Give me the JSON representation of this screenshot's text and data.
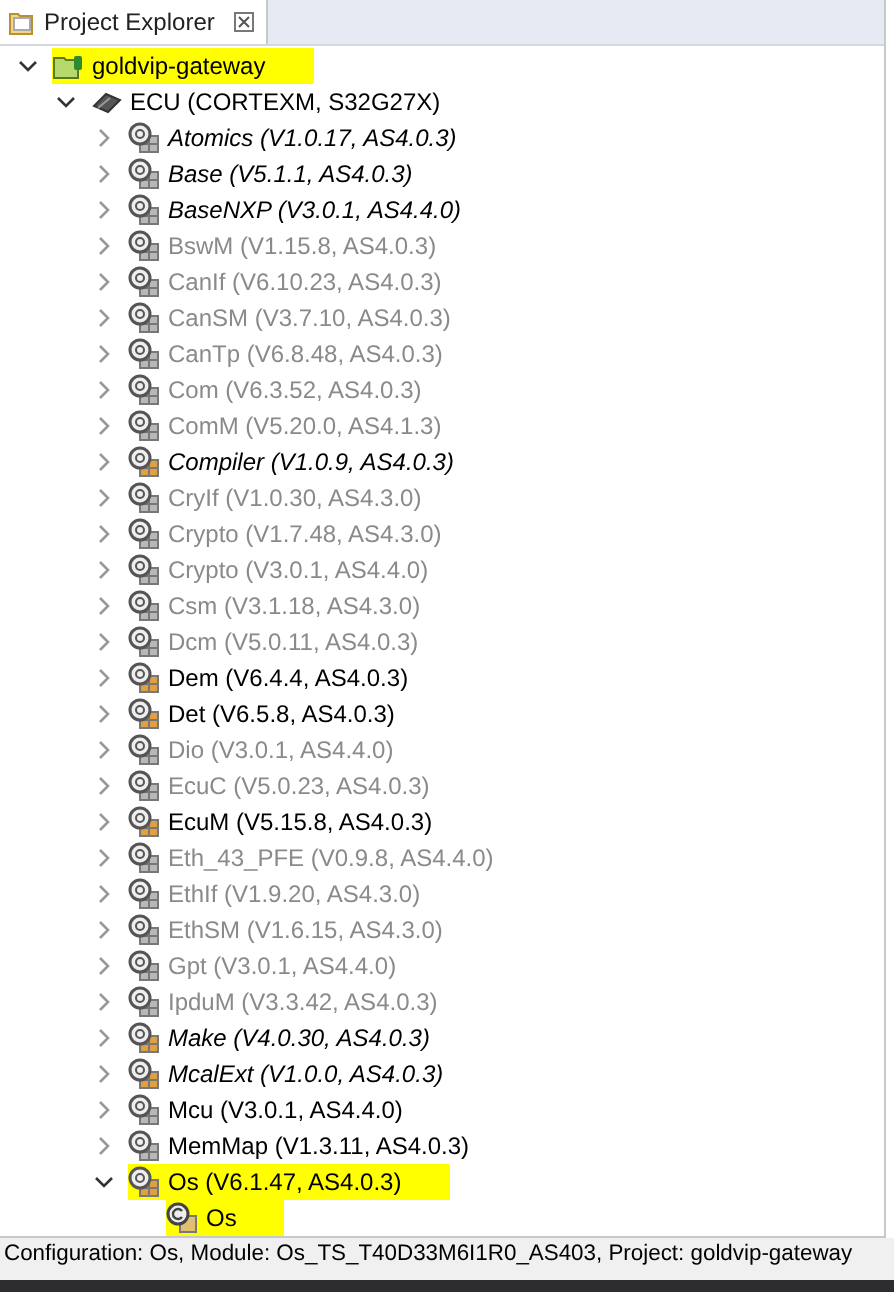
{
  "tab": {
    "title": "Project Explorer",
    "selected": true
  },
  "tree": [
    {
      "kind": "project",
      "label": "goldvip-gateway",
      "expanded": true,
      "highlighted": true,
      "children": [
        {
          "kind": "ecu",
          "label": "ECU (CORTEXM, S32G27X)",
          "expanded": true,
          "highlighted": false,
          "children": [
            {
              "kind": "module",
              "label": "Atomics (V1.0.17, AS4.0.3)",
              "read_only": true,
              "disabled": false,
              "enabled": false,
              "expanded": false,
              "highlighted": false
            },
            {
              "kind": "module",
              "label": "Base (V5.1.1, AS4.0.3)",
              "read_only": true,
              "disabled": false,
              "enabled": false,
              "expanded": false,
              "highlighted": false
            },
            {
              "kind": "module",
              "label": "BaseNXP (V3.0.1, AS4.4.0)",
              "read_only": true,
              "disabled": false,
              "enabled": false,
              "expanded": false,
              "highlighted": false
            },
            {
              "kind": "module",
              "label": "BswM (V1.15.8, AS4.0.3)",
              "read_only": false,
              "disabled": true,
              "enabled": false,
              "expanded": false,
              "highlighted": false
            },
            {
              "kind": "module",
              "label": "CanIf (V6.10.23, AS4.0.3)",
              "read_only": false,
              "disabled": true,
              "enabled": false,
              "expanded": false,
              "highlighted": false
            },
            {
              "kind": "module",
              "label": "CanSM (V3.7.10, AS4.0.3)",
              "read_only": false,
              "disabled": true,
              "enabled": false,
              "expanded": false,
              "highlighted": false
            },
            {
              "kind": "module",
              "label": "CanTp (V6.8.48, AS4.0.3)",
              "read_only": false,
              "disabled": true,
              "enabled": false,
              "expanded": false,
              "highlighted": false
            },
            {
              "kind": "module",
              "label": "Com (V6.3.52, AS4.0.3)",
              "read_only": false,
              "disabled": true,
              "enabled": false,
              "expanded": false,
              "highlighted": false
            },
            {
              "kind": "module",
              "label": "ComM (V5.20.0, AS4.1.3)",
              "read_only": false,
              "disabled": true,
              "enabled": false,
              "expanded": false,
              "highlighted": false
            },
            {
              "kind": "module",
              "label": "Compiler (V1.0.9, AS4.0.3)",
              "read_only": true,
              "disabled": false,
              "enabled": true,
              "expanded": false,
              "highlighted": false
            },
            {
              "kind": "module",
              "label": "CryIf (V1.0.30, AS4.3.0)",
              "read_only": false,
              "disabled": true,
              "enabled": false,
              "expanded": false,
              "highlighted": false
            },
            {
              "kind": "module",
              "label": "Crypto (V1.7.48, AS4.3.0)",
              "read_only": false,
              "disabled": true,
              "enabled": false,
              "expanded": false,
              "highlighted": false
            },
            {
              "kind": "module",
              "label": "Crypto (V3.0.1, AS4.4.0)",
              "read_only": false,
              "disabled": true,
              "enabled": false,
              "expanded": false,
              "highlighted": false
            },
            {
              "kind": "module",
              "label": "Csm (V3.1.18, AS4.3.0)",
              "read_only": false,
              "disabled": true,
              "enabled": false,
              "expanded": false,
              "highlighted": false
            },
            {
              "kind": "module",
              "label": "Dcm (V5.0.11, AS4.0.3)",
              "read_only": false,
              "disabled": true,
              "enabled": false,
              "expanded": false,
              "highlighted": false
            },
            {
              "kind": "module",
              "label": "Dem (V6.4.4, AS4.0.3)",
              "read_only": false,
              "disabled": false,
              "enabled": true,
              "expanded": false,
              "highlighted": false
            },
            {
              "kind": "module",
              "label": "Det (V6.5.8, AS4.0.3)",
              "read_only": false,
              "disabled": false,
              "enabled": true,
              "expanded": false,
              "highlighted": false
            },
            {
              "kind": "module",
              "label": "Dio (V3.0.1, AS4.4.0)",
              "read_only": false,
              "disabled": true,
              "enabled": false,
              "expanded": false,
              "highlighted": false
            },
            {
              "kind": "module",
              "label": "EcuC (V5.0.23, AS4.0.3)",
              "read_only": false,
              "disabled": true,
              "enabled": false,
              "expanded": false,
              "highlighted": false
            },
            {
              "kind": "module",
              "label": "EcuM (V5.15.8, AS4.0.3)",
              "read_only": false,
              "disabled": false,
              "enabled": true,
              "expanded": false,
              "highlighted": false
            },
            {
              "kind": "module",
              "label": "Eth_43_PFE (V0.9.8, AS4.4.0)",
              "read_only": false,
              "disabled": true,
              "enabled": false,
              "expanded": false,
              "highlighted": false
            },
            {
              "kind": "module",
              "label": "EthIf (V1.9.20, AS4.3.0)",
              "read_only": false,
              "disabled": true,
              "enabled": false,
              "expanded": false,
              "highlighted": false
            },
            {
              "kind": "module",
              "label": "EthSM (V1.6.15, AS4.3.0)",
              "read_only": false,
              "disabled": true,
              "enabled": false,
              "expanded": false,
              "highlighted": false
            },
            {
              "kind": "module",
              "label": "Gpt (V3.0.1, AS4.4.0)",
              "read_only": false,
              "disabled": true,
              "enabled": false,
              "expanded": false,
              "highlighted": false
            },
            {
              "kind": "module",
              "label": "IpduM (V3.3.42, AS4.0.3)",
              "read_only": false,
              "disabled": true,
              "enabled": false,
              "expanded": false,
              "highlighted": false
            },
            {
              "kind": "module",
              "label": "Make (V4.0.30, AS4.0.3)",
              "read_only": true,
              "disabled": false,
              "enabled": true,
              "expanded": false,
              "highlighted": false
            },
            {
              "kind": "module",
              "label": "McalExt (V1.0.0, AS4.0.3)",
              "read_only": true,
              "disabled": false,
              "enabled": true,
              "expanded": false,
              "highlighted": false
            },
            {
              "kind": "module",
              "label": "Mcu (V3.0.1, AS4.4.0)",
              "read_only": false,
              "disabled": false,
              "enabled": false,
              "expanded": false,
              "highlighted": false
            },
            {
              "kind": "module",
              "label": "MemMap (V1.3.11, AS4.0.3)",
              "read_only": false,
              "disabled": false,
              "enabled": false,
              "expanded": false,
              "highlighted": false
            },
            {
              "kind": "module",
              "label": "Os (V6.1.47, AS4.0.3)",
              "read_only": false,
              "disabled": false,
              "enabled": true,
              "expanded": true,
              "highlighted": true,
              "children": [
                {
                  "kind": "config",
                  "label": "Os",
                  "highlighted": true
                }
              ]
            }
          ]
        }
      ]
    }
  ],
  "status_bar": "Configuration: Os, Module: Os_TS_T40D33M6I1R0_AS403, Project: goldvip-gateway"
}
